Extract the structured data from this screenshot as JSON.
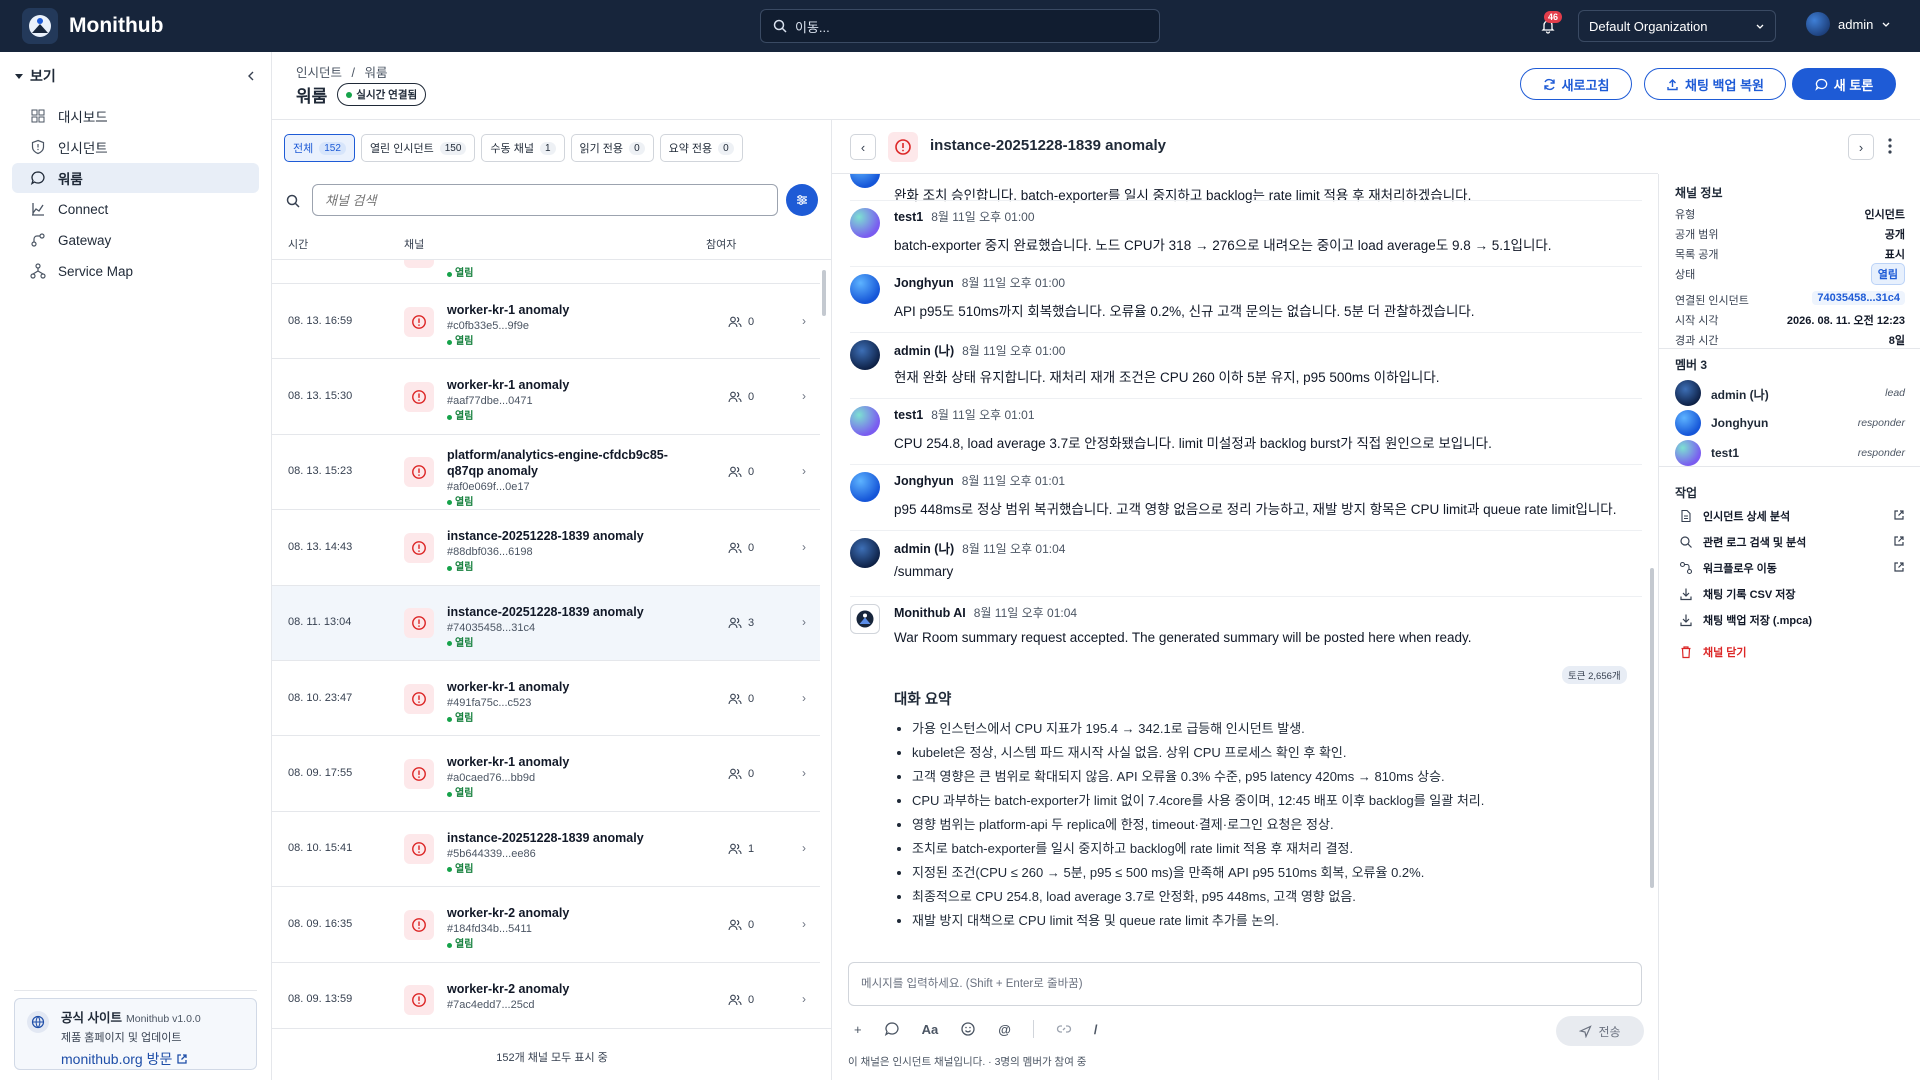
{
  "app": {
    "name": "Monithub"
  },
  "topbar": {
    "search_placeholder": "이동...",
    "notifications_count": "46",
    "org": "Default Organization",
    "user": "admin"
  },
  "sidebar": {
    "section": "보기",
    "items": [
      {
        "label": "대시보드",
        "icon": "dashboard-icon"
      },
      {
        "label": "인시던트",
        "icon": "shield-icon"
      },
      {
        "label": "워룸",
        "icon": "chat-icon"
      },
      {
        "label": "Connect",
        "icon": "chart-icon"
      },
      {
        "label": "Gateway",
        "icon": "route-icon"
      },
      {
        "label": "Service Map",
        "icon": "network-icon"
      }
    ],
    "promo": {
      "title": "공식 사이트",
      "version": "Monithub v1.0.0",
      "desc": "제품 홈페이지 및 업데이트",
      "link": "monithub.org 방문"
    }
  },
  "header": {
    "breadcrumb_root": "인시던트",
    "breadcrumb_sep": "/",
    "breadcrumb_current": "워룸",
    "title": "워룸",
    "live_label": "실시간 연결됨",
    "refresh_label": "새로고침",
    "restore_label": "채팅 백업 복원",
    "new_label": "새 토론"
  },
  "channels": {
    "filters": [
      {
        "label": "전체",
        "count": "152"
      },
      {
        "label": "열린 인시던트",
        "count": "150"
      },
      {
        "label": "수동 채널",
        "count": "1"
      },
      {
        "label": "읽기 전용",
        "count": "0"
      },
      {
        "label": "요약 전용",
        "count": "0"
      }
    ],
    "search_placeholder": "채널 검색",
    "columns": {
      "time": "시간",
      "channel": "채널",
      "members": "참여자"
    },
    "partial_status": "열림",
    "rows": [
      {
        "time": "08. 13. 16:59",
        "name": "worker-kr-1 anomaly",
        "name2": "",
        "id": "#c0fb33e5...9f9e",
        "status": "열림",
        "count": "0"
      },
      {
        "time": "08. 13. 15:30",
        "name": "worker-kr-1 anomaly",
        "name2": "",
        "id": "#aaf77dbe...0471",
        "status": "열림",
        "count": "0"
      },
      {
        "time": "08. 13. 15:23",
        "name": "platform/analytics-engine-cfdcb9c85-",
        "name2": "q87qp anomaly",
        "id": "#af0e069f...0e17",
        "status": "열림",
        "count": "0"
      },
      {
        "time": "08. 13. 14:43",
        "name": "instance-20251228-1839 anomaly",
        "name2": "",
        "id": "#88dbf036...6198",
        "status": "열림",
        "count": "0"
      },
      {
        "time": "08. 11. 13:04",
        "name": "instance-20251228-1839 anomaly",
        "name2": "",
        "id": "#74035458...31c4",
        "status": "열림",
        "count": "3"
      },
      {
        "time": "08. 10. 23:47",
        "name": "worker-kr-1 anomaly",
        "name2": "",
        "id": "#491fa75c...c523",
        "status": "열림",
        "count": "0"
      },
      {
        "time": "08. 09. 17:55",
        "name": "worker-kr-1 anomaly",
        "name2": "",
        "id": "#a0caed76...bb9d",
        "status": "열림",
        "count": "0"
      },
      {
        "time": "08. 10. 15:41",
        "name": "instance-20251228-1839 anomaly",
        "name2": "",
        "id": "#5b644339...ee86",
        "status": "열림",
        "count": "1"
      },
      {
        "time": "08. 09. 16:35",
        "name": "worker-kr-2 anomaly",
        "name2": "",
        "id": "#184fd34b...5411",
        "status": "열림",
        "count": "0"
      },
      {
        "time": "08. 09. 13:59",
        "name": "worker-kr-2 anomaly",
        "name2": "",
        "id": "#7ac4edd7...25cd",
        "status": "",
        "count": "0"
      }
    ],
    "footer": "152개 채널 모두 표시 중"
  },
  "chat": {
    "title": "instance-20251228-1839 anomaly",
    "partial_text": "완화 조치 승인합니다. batch-exporter를 일시 중지하고 backlog는 rate limit 적용 후 재처리하겠습니다.",
    "messages": [
      {
        "author": "test1",
        "time": "8월 11일 오후 01:00",
        "text": "batch-exporter 중지 완료했습니다. 노드 CPU가 318 → 276으로 내려오는 중이고 load average도 9.8 → 5.1입니다."
      },
      {
        "author": "Jonghyun",
        "time": "8월 11일 오후 01:00",
        "text": "API p95도 510ms까지 회복했습니다. 오류율 0.2%, 신규 고객 문의는 없습니다. 5분 더 관찰하겠습니다."
      },
      {
        "author": "admin (나)",
        "time": "8월 11일 오후 01:00",
        "text": "현재 완화 상태 유지합니다. 재처리 재개 조건은 CPU 260 이하 5분 유지, p95 500ms 이하입니다."
      },
      {
        "author": "test1",
        "time": "8월 11일 오후 01:01",
        "text": "CPU 254.8, load average 3.7로 안정화됐습니다. limit 미설정과 backlog burst가 직접 원인으로 보입니다."
      },
      {
        "author": "Jonghyun",
        "time": "8월 11일 오후 01:01",
        "text": "p95 448ms로 정상 범위 복귀했습니다. 고객 영향 없음으로 정리 가능하고, 재발 방지 항목은 CPU limit과 queue rate limit입니다."
      },
      {
        "author": "admin (나)",
        "time": "8월 11일 오후 01:04",
        "text": "/summary"
      },
      {
        "author": "Monithub AI",
        "time": "8월 11일 오후 01:04",
        "text": "War Room summary request accepted. The generated summary will be posted here when ready."
      }
    ],
    "token_badge": "토큰 2,656개",
    "summary_title": "대화 요약",
    "summary": [
      "가용 인스턴스에서 CPU 지표가 195.4 → 342.1로 급등해 인시던트 발생.",
      "kubelet은 정상, 시스템 파드 재시작 사실 없음. 상위 CPU 프로세스 확인 후 확인.",
      "고객 영향은 큰 범위로 확대되지 않음. API 오류율 0.3% 수준, p95 latency 420ms → 810ms 상승.",
      "CPU 과부하는 batch-exporter가 limit 없이 7.4core를 사용 중이며, 12:45 배포 이후 backlog를 일괄 처리.",
      "영향 범위는 platform-api 두 replica에 한정, timeout·결제·로그인 요청은 정상.",
      "조치로 batch-exporter를 일시 중지하고 backlog에 rate limit 적용 후 재처리 결정.",
      "지정된 조건(CPU ≤ 260 → 5분, p95 ≤ 500 ms)을 만족해 API p95 510ms 회복, 오류율 0.2%.",
      "최종적으로 CPU 254.8, load average 3.7로 안정화, p95 448ms, 고객 영향 없음.",
      "재발 방지 대책으로 CPU limit 적용 및 queue rate limit 추가를 논의."
    ],
    "composer_placeholder": "메시지를 입력하세요. (Shift + Enter로 줄바꿈)",
    "tools": {
      "plus": "+",
      "format": "Aa",
      "mention": "@",
      "slash": "/"
    },
    "send_label": "전송",
    "footer": "이 채널은 인시던트 채널입니다. · 3명의 멤버가 참여 중"
  },
  "info": {
    "title": "채널 정보",
    "fields": [
      {
        "k": "유형",
        "v": "인시던트",
        "kind": "text"
      },
      {
        "k": "공개 범위",
        "v": "공개",
        "kind": "text"
      },
      {
        "k": "목록 공개",
        "v": "표시",
        "kind": "text"
      },
      {
        "k": "상태",
        "v": "열림",
        "kind": "badge"
      },
      {
        "k": "연결된 인시던트",
        "v": "74035458...31c4",
        "kind": "link"
      },
      {
        "k": "시작 시각",
        "v": "2026. 08. 11. 오전 12:23",
        "kind": "text"
      },
      {
        "k": "경과 시간",
        "v": "8일",
        "kind": "text"
      }
    ],
    "members_title": "멤버 3",
    "members": [
      {
        "name": "admin (나)",
        "role": "lead",
        "av": "admin"
      },
      {
        "name": "Jonghyun",
        "role": "responder",
        "av": "jong"
      },
      {
        "name": "test1",
        "role": "responder",
        "av": "test"
      }
    ],
    "actions_title": "작업",
    "actions": [
      {
        "label": "인시던트 상세 분석",
        "icon": "document-icon",
        "ext": true
      },
      {
        "label": "관련 로그 검색 및 분석",
        "icon": "search-icon",
        "ext": true
      },
      {
        "label": "워크플로우 이동",
        "icon": "workflow-icon",
        "ext": true
      },
      {
        "label": "채팅 기록 CSV 저장",
        "icon": "download-icon",
        "ext": false
      },
      {
        "label": "채팅 백업 저장 (.mpca)",
        "icon": "download-icon",
        "ext": false
      },
      {
        "label": "채널 닫기",
        "icon": "trash-icon",
        "ext": false,
        "danger": true
      }
    ]
  },
  "colors": {
    "topbar": "#17253b",
    "accent": "#1e5bd6",
    "danger": "#dc2626",
    "success": "#16a34a"
  }
}
